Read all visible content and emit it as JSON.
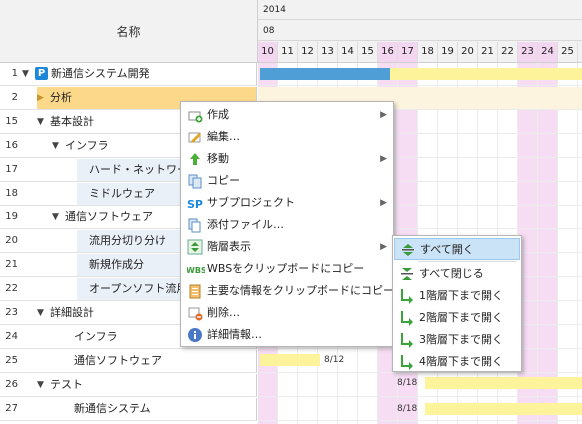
{
  "header": {
    "name_label": "名称",
    "year": "2014",
    "month": "08",
    "days": [
      "10",
      "11",
      "12",
      "13",
      "14",
      "15",
      "16",
      "17",
      "18",
      "19",
      "20",
      "21",
      "22",
      "23",
      "24",
      "25"
    ]
  },
  "rows": [
    {
      "num": "1",
      "label": "新通信システム開発"
    },
    {
      "num": "2",
      "label": "分析"
    },
    {
      "num": "15",
      "label": "基本設計"
    },
    {
      "num": "16",
      "label": "インフラ"
    },
    {
      "num": "17",
      "label": "ハード・ネットワーク構"
    },
    {
      "num": "18",
      "label": "ミドルウェア"
    },
    {
      "num": "19",
      "label": "通信ソフトウェア"
    },
    {
      "num": "20",
      "label": "流用分切り分け"
    },
    {
      "num": "21",
      "label": "新規作成分"
    },
    {
      "num": "22",
      "label": "オープンソフト流用"
    },
    {
      "num": "23",
      "label": "詳細設計"
    },
    {
      "num": "24",
      "label": "インフラ"
    },
    {
      "num": "25",
      "label": "通信ソフトウェア"
    },
    {
      "num": "26",
      "label": "テスト"
    },
    {
      "num": "27",
      "label": "新通信システム"
    }
  ],
  "gantt": {
    "date_25": "8/12",
    "date_26": "8/18",
    "date_27": "8/18"
  },
  "context_menu": {
    "items": [
      {
        "label": "作成",
        "icon": "create-icon"
      },
      {
        "label": "編集…",
        "icon": "edit-icon"
      },
      {
        "label": "移動",
        "icon": "move-up-icon"
      },
      {
        "label": "コピー",
        "icon": "copy-icon"
      },
      {
        "label": "サブプロジェクト",
        "icon": "subproject-icon",
        "icon_text": "SP"
      },
      {
        "label": "添付ファイル…",
        "icon": "attachment-icon"
      },
      {
        "label": "階層表示",
        "icon": "hierarchy-icon"
      },
      {
        "label": "WBSをクリップボードにコピー",
        "icon": "wbs-icon",
        "icon_text": "WBS"
      },
      {
        "label": "主要な情報をクリップボードにコピー",
        "icon": "clipboard-icon"
      },
      {
        "label": "削除…",
        "icon": "delete-icon"
      },
      {
        "label": "詳細情報…",
        "icon": "info-icon"
      }
    ]
  },
  "submenu": {
    "items": [
      {
        "label": "すべて開く",
        "icon": "expand-all-icon"
      },
      {
        "label": "すべて閉じる",
        "icon": "collapse-all-icon"
      },
      {
        "label": "1階層下まで開く",
        "icon": "green-arrow-icon"
      },
      {
        "label": "2階層下まで開く",
        "icon": "green-arrow-icon"
      },
      {
        "label": "3階層下まで開く",
        "icon": "green-arrow-icon"
      },
      {
        "label": "4階層下まで開く",
        "icon": "green-arrow-icon"
      }
    ]
  },
  "colors": {
    "selected_row": "#fcd98a",
    "weekend": "#f3d6f0",
    "bar_blue": "#4f9fd6",
    "bar_yellow": "#fcf39a",
    "menu_highlight": "#cbe3f7"
  }
}
